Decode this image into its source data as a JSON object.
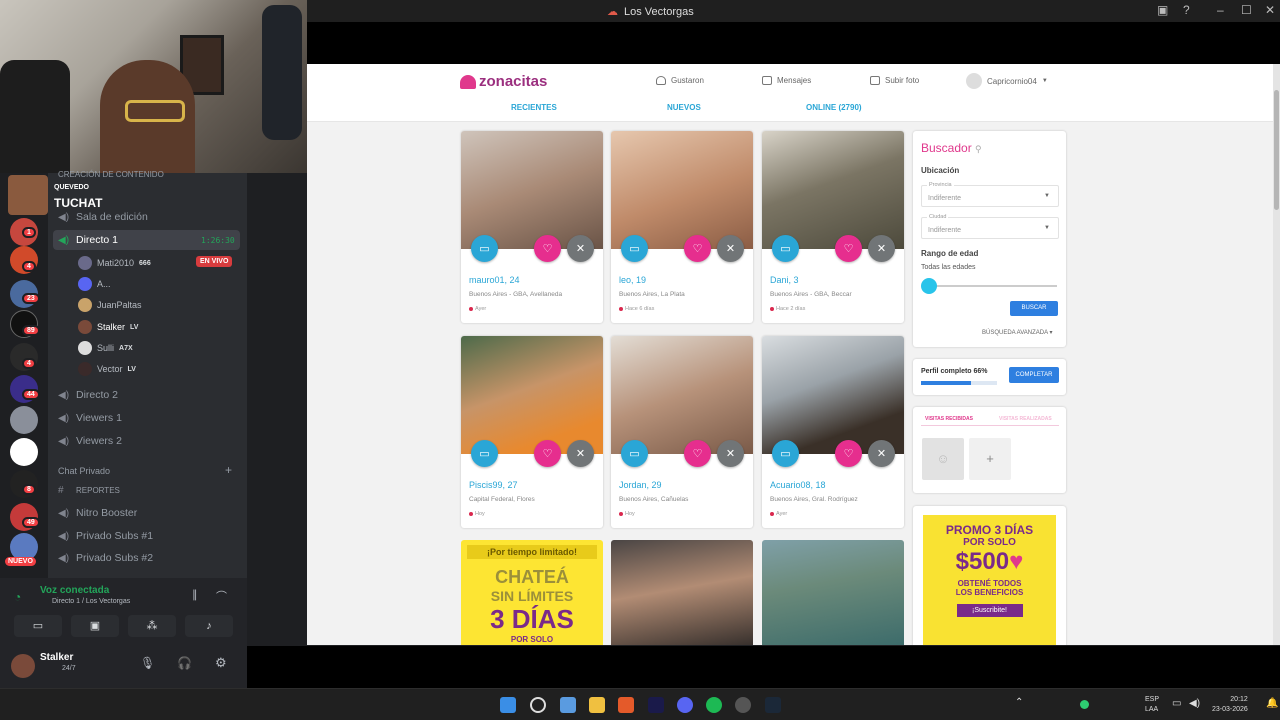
{
  "window": {
    "title": "Los Vectorgas"
  },
  "site": {
    "logo": "zonacitas",
    "nav": {
      "gustaron": "Gustaron",
      "mensajes": "Mensajes",
      "subir_foto": "Subir foto",
      "user": "Capricornio04"
    },
    "tabs": [
      "RECIENTES",
      "NUEVOS",
      "ONLINE (2790)"
    ],
    "profiles": [
      {
        "name": "mauro01, 24",
        "location": "Buenos Aires - GBA, Avellaneda",
        "seen": "Ayer"
      },
      {
        "name": "leo, 19",
        "location": "Buenos Aires, La Plata",
        "seen": "Hace 6 días"
      },
      {
        "name": "Dani, 3",
        "location": "Buenos Aires - GBA, Beccar",
        "seen": "Hace 2 días"
      },
      {
        "name": "Piscis99, 27",
        "location": "Capital Federal, Flores",
        "seen": "Hoy"
      },
      {
        "name": "Jordan, 29",
        "location": "Buenos Aires, Cañuelas",
        "seen": "Hoy"
      },
      {
        "name": "Acuario08, 18",
        "location": "Buenos Aires, Gral. Rodríguez",
        "seen": "Ayer"
      }
    ],
    "promo_card": {
      "top": "¡Por tiempo limitado!",
      "line1": "CHATEÁ",
      "line2": "SIN LÍMITES",
      "line3": "3 DÍAS",
      "line4": "POR SOLO"
    },
    "buscador": {
      "title": "Buscador",
      "ubicacion": "Ubicación",
      "provincia_label": "Provincia",
      "provincia_value": "Indiferente",
      "ciudad_label": "Ciudad",
      "ciudad_value": "Indiferente",
      "rango": "Rango de edad",
      "rango_value": "Todas las edades",
      "buscar": "BUSCAR",
      "avanzada": "BÚSQUEDA AVANZADA"
    },
    "perfil": {
      "label": "Perfil completo 66%",
      "progress": 0.66,
      "button": "COMPLETAR"
    },
    "visitas": {
      "tab1": "VISITAS RECIBIDAS",
      "tab2": "VISITAS REALIZADAS"
    },
    "promo_side": {
      "line1": "PROMO 3 DÍAS",
      "line2": "POR SOLO",
      "price": "$500",
      "line3": "OBTENÉ TODOS",
      "line4": "LOS BENEFICIOS",
      "button": "¡Suscribite!"
    }
  },
  "discord": {
    "category": "CREACIÓN DE CONTENIDO",
    "server_tag": "QUEVEDO",
    "server_name": "TUCHAT",
    "channels_top": [
      "Sala de edición"
    ],
    "active_channel": {
      "name": "Directo 1",
      "time": "1:26:30"
    },
    "users": [
      {
        "name": "Mati2010",
        "tag": "666",
        "live": "EN VIVO"
      },
      {
        "name": "A...",
        "tag": ""
      },
      {
        "name": "JuanPaltas",
        "tag": ""
      },
      {
        "name": "Stalker",
        "tag": "LV"
      },
      {
        "name": "Sulli",
        "tag": "A7X"
      },
      {
        "name": "Vector",
        "tag": "LV"
      }
    ],
    "voice_channels": [
      "Directo 2",
      "Viewers 1",
      "Viewers 2"
    ],
    "private_category": "Chat Privado",
    "private_channels": [
      "REPORTES",
      "Nitro Booster",
      "Privado Subs #1",
      "Privado Subs #2"
    ],
    "guild_badges": [
      "1",
      "4",
      "23",
      "89",
      "4",
      "44",
      "8",
      "49"
    ],
    "nuevo": "NUEVO",
    "voice_status": "Voz conectada",
    "voice_sub": "Directo 1 / Los Vectorgas",
    "self_user": "Stalker",
    "self_status": "24/7"
  },
  "taskbar": {
    "lang1": "ESP",
    "lang2": "LAA",
    "time": "20:12",
    "date": "23-03-2026"
  }
}
